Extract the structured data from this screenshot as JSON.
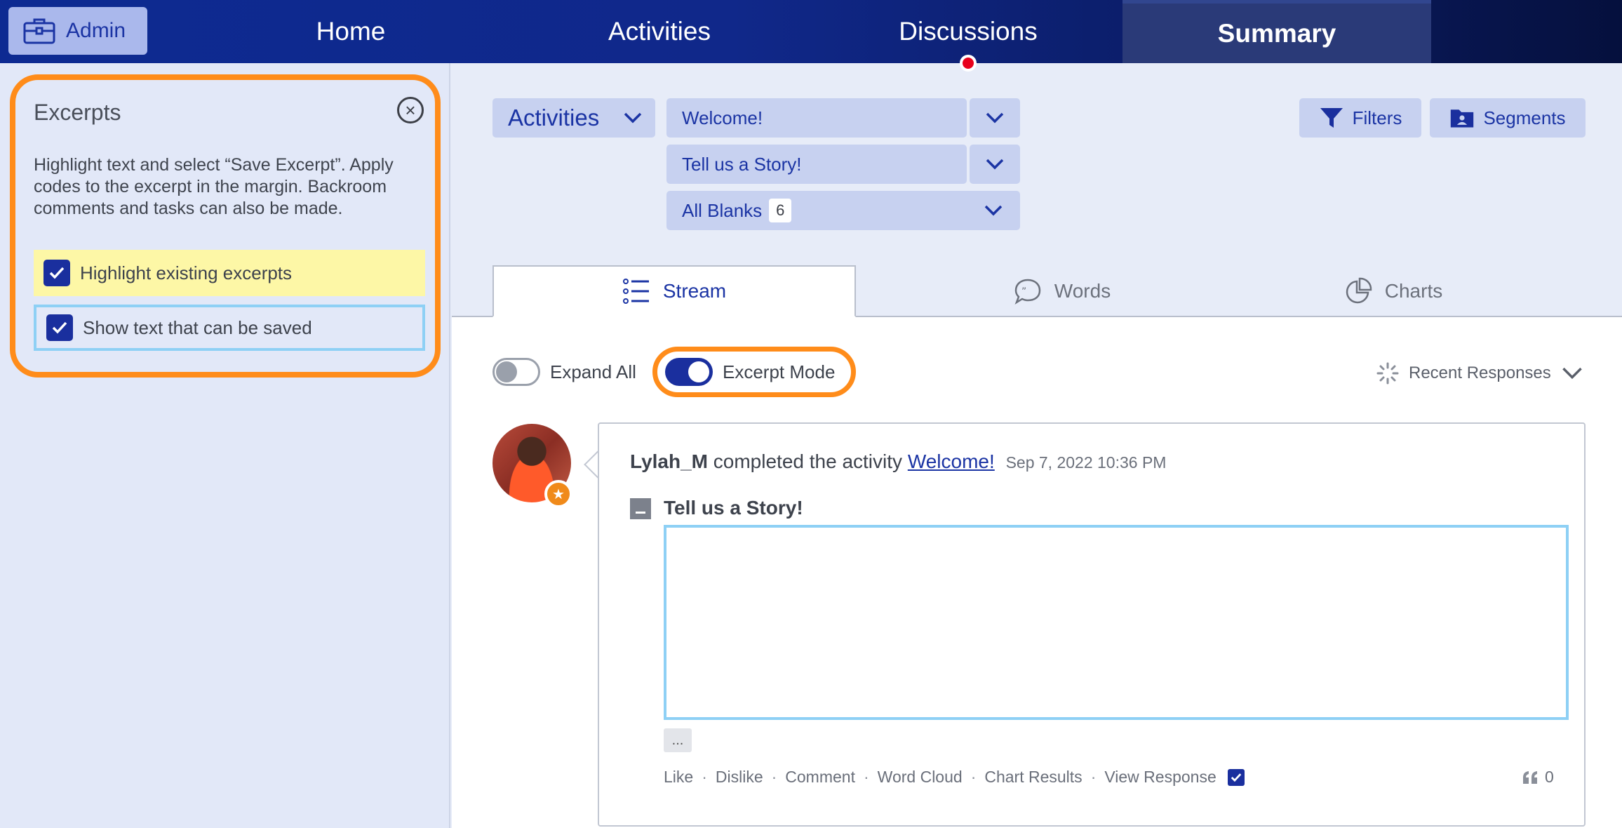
{
  "topnav": {
    "admin_label": "Admin",
    "tabs": [
      {
        "label": "Home"
      },
      {
        "label": "Activities"
      },
      {
        "label": "Discussions"
      },
      {
        "label": "Summary"
      }
    ],
    "active_tab": "Summary"
  },
  "sidebar": {
    "title": "Excerpts",
    "description": "Highlight text and select “Save Excerpt”. Apply codes to the excerpt in the margin. Backroom comments and tasks can also be made.",
    "options": [
      {
        "label": "Highlight existing excerpts",
        "checked": true
      },
      {
        "label": "Show text that can be saved",
        "checked": true
      }
    ]
  },
  "filters": {
    "activities_label": "Activities",
    "activity_select": "Welcome!",
    "question_select": "Tell us a Story!",
    "blanks_select": "All Blanks",
    "blanks_count": "6",
    "filters_label": "Filters",
    "segments_label": "Segments"
  },
  "view_tabs": [
    {
      "label": "Stream",
      "icon": "list-icon"
    },
    {
      "label": "Words",
      "icon": "speech-bubble-icon"
    },
    {
      "label": "Charts",
      "icon": "pie-chart-icon"
    }
  ],
  "controls": {
    "expand_all_label": "Expand All",
    "expand_all_on": false,
    "excerpt_mode_label": "Excerpt Mode",
    "excerpt_mode_on": true,
    "sort_label": "Recent Responses"
  },
  "response": {
    "user": "Lylah_M",
    "action_text": "completed the activity",
    "activity_link": "Welcome!",
    "timestamp": "Sep 7, 2022 10:36 PM",
    "question": "Tell us a Story!",
    "more_label": "...",
    "actions": [
      "Like",
      "Dislike",
      "Comment",
      "Word Cloud",
      "Chart Results",
      "View Response"
    ],
    "quote_count": "0"
  },
  "colors": {
    "accent": "#1a2f9e",
    "highlight_orange": "#ff8c1a",
    "excerpt_yellow": "#fdf7a6",
    "saveable_blue": "#8ed0f5",
    "notification_red": "#e8001c"
  }
}
